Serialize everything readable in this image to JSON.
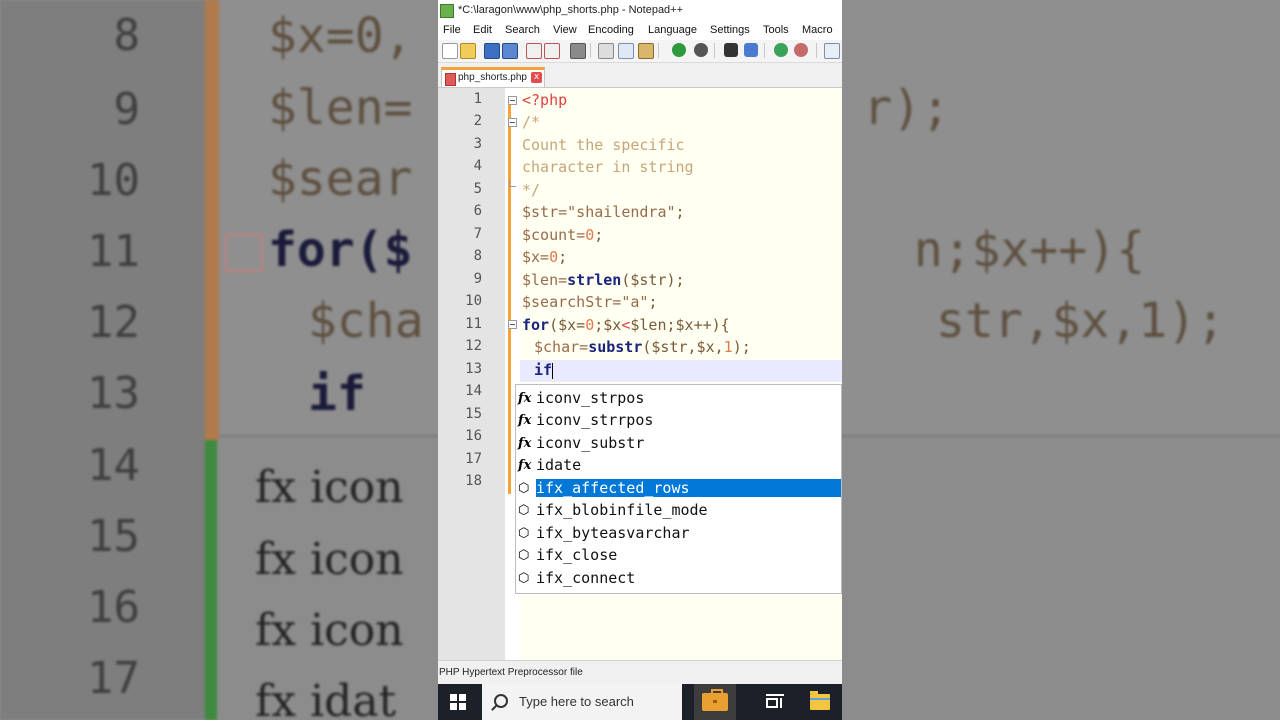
{
  "background": {
    "line_numbers": [
      "8",
      "9",
      "10",
      "11",
      "12",
      "13",
      "14",
      "15",
      "16",
      "17"
    ],
    "code_fragments": [
      "$x=0,",
      "$len=",
      "$sear",
      "for($",
      "$cha",
      "if"
    ],
    "right_fragments": [
      "r);",
      "n;$x++){",
      "str,$x,1);"
    ],
    "fx_fragments": [
      "fx icon",
      "fx icon",
      "fx icon",
      "fx idat"
    ]
  },
  "window": {
    "title": "*C:\\laragon\\www\\php_shorts.php - Notepad++"
  },
  "menu": {
    "items": [
      "File",
      "Edit",
      "Search",
      "View",
      "Encoding",
      "Language",
      "Settings",
      "Tools",
      "Macro"
    ]
  },
  "toolbar": {
    "icons": [
      "new-file-icon",
      "open-file-icon",
      "save-icon",
      "save-all-icon",
      "close-icon",
      "close-all-icon",
      "print-icon",
      "cut-icon",
      "copy-icon",
      "paste-icon",
      "undo-icon",
      "redo-icon",
      "find-icon",
      "replace-icon",
      "zoom-in-icon",
      "zoom-out-icon",
      "sync-icon"
    ]
  },
  "tab": {
    "label": "php_shorts.php",
    "close": "x"
  },
  "editor": {
    "line_numbers": [
      "1",
      "2",
      "3",
      "4",
      "5",
      "6",
      "7",
      "8",
      "9",
      "10",
      "11",
      "12",
      "13",
      "14",
      "15",
      "16",
      "17",
      "18"
    ],
    "lines": {
      "l1": "<?php",
      "l2": "/*",
      "l3": "Count the specific",
      "l4": "character in string",
      "l5": "*/",
      "l6_var": "$str=",
      "l6_str": "\"shailendra\"",
      "l6_end": ";",
      "l7_var": "$count=",
      "l7_num": "0",
      "l7_end": ";",
      "l8_var": "$x=",
      "l8_num": "0",
      "l8_end": ";",
      "l9_var": "$len=",
      "l9_fn": "strlen",
      "l9_rest": "($str);",
      "l10_var": "$searchStr=",
      "l10_str": "\"a\"",
      "l10_end": ";",
      "l11_kw": "for",
      "l11_a": "($x=",
      "l11_num": "0",
      "l11_b": ";$x",
      "l11_op": "<",
      "l11_c": "$len;$x++){",
      "l12_var": "$char=",
      "l12_fn": "substr",
      "l12_a": "($str,$x,",
      "l12_num": "1",
      "l12_b": ");",
      "l13_kw": "if"
    }
  },
  "autocomplete": {
    "items": [
      {
        "icon": "fx",
        "label": "iconv_strpos"
      },
      {
        "icon": "fx",
        "label": "iconv_strrpos"
      },
      {
        "icon": "fx",
        "label": "iconv_substr"
      },
      {
        "icon": "fx",
        "label": "idate"
      },
      {
        "icon": "⬡",
        "label": "ifx_affected_rows",
        "selected": true
      },
      {
        "icon": "⬡",
        "label": "ifx_blobinfile_mode"
      },
      {
        "icon": "⬡",
        "label": "ifx_byteasvarchar"
      },
      {
        "icon": "⬡",
        "label": "ifx_close"
      },
      {
        "icon": "⬡",
        "label": "ifx_connect"
      }
    ]
  },
  "status": {
    "language": "PHP Hypertext Preprocessor file"
  },
  "taskbar": {
    "search_placeholder": "Type here to search"
  },
  "colors": {
    "accent_tab": "#f7a23b",
    "selection": "#0078d7",
    "keyword": "#1a237e",
    "php_tag": "#e04040",
    "comment": "#c6a57a"
  }
}
